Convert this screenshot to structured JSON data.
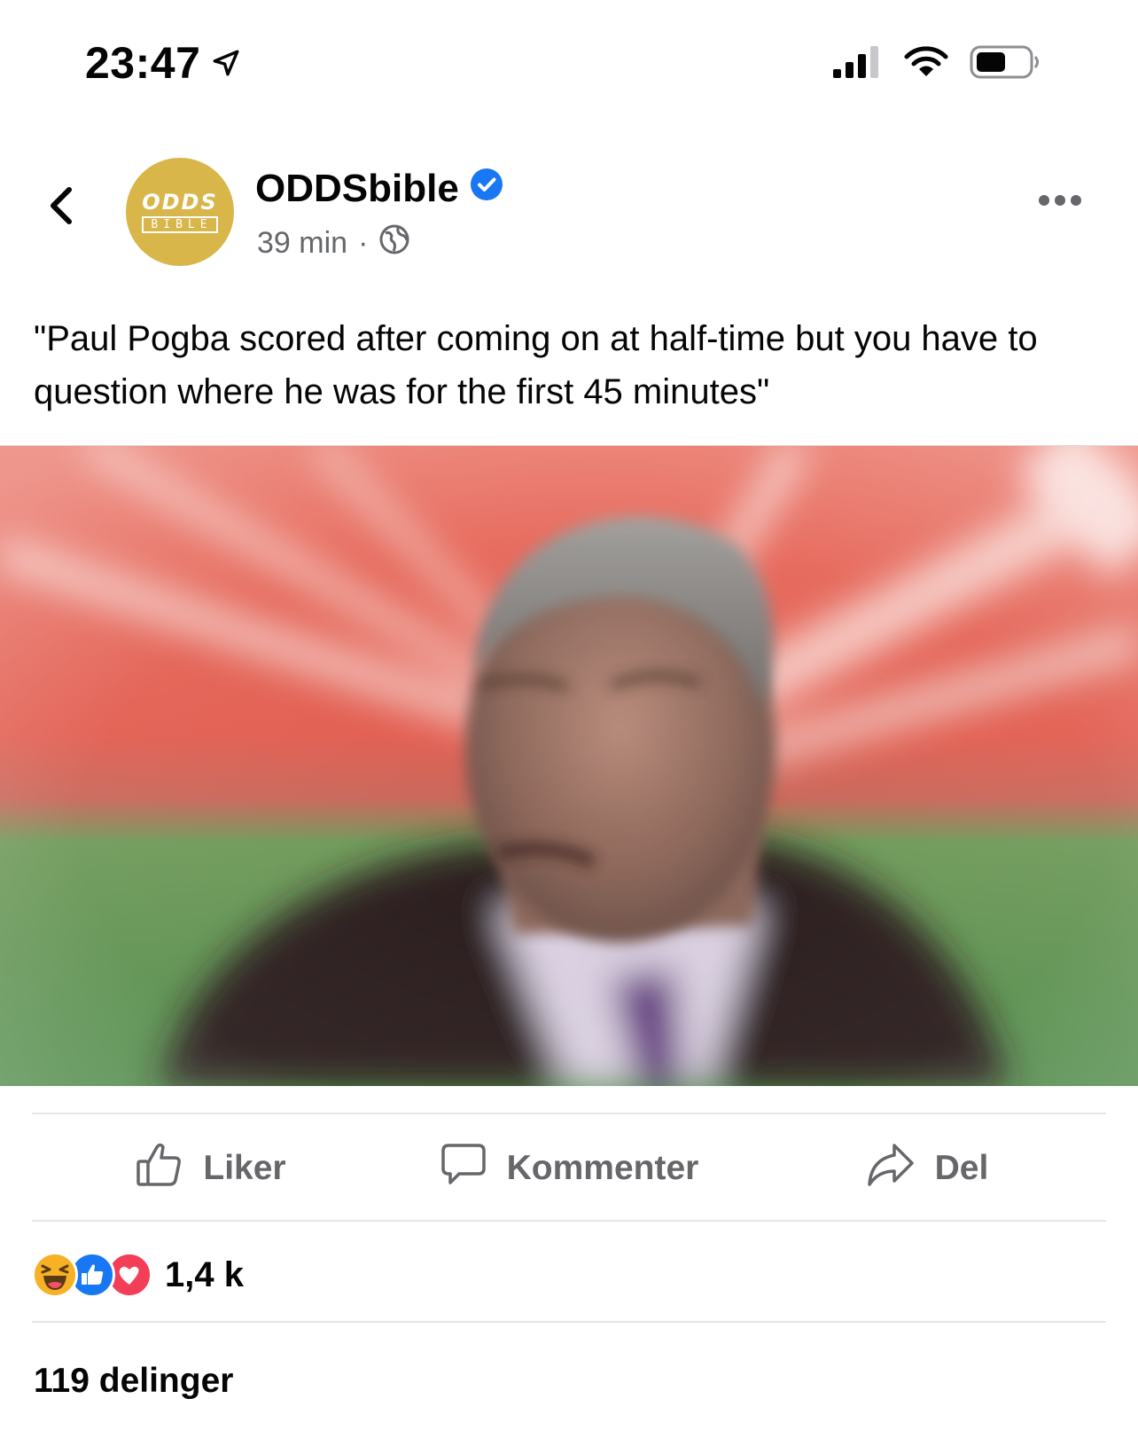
{
  "status_bar": {
    "time": "23:47",
    "icons": [
      "location-arrow-icon",
      "signal-icon",
      "wifi-icon",
      "battery-icon"
    ]
  },
  "post": {
    "page_name": "ODDSbible",
    "verified": true,
    "avatar_text_top": "ODDS",
    "avatar_text_bottom": "BIBLE",
    "time_ago": "39 min",
    "separator": "·",
    "audience_icon": "globe-icon",
    "text": "\"Paul Pogba scored after coming on at half-time but you have to question where he was for the first 45 minutes\"",
    "image_description_icon": "photo"
  },
  "actions": {
    "like_label": "Liker",
    "comment_label": "Kommenter",
    "share_label": "Del"
  },
  "reactions": {
    "types": [
      "haha",
      "like",
      "love"
    ],
    "count": "1,4 k"
  },
  "shares": {
    "label": "119 delinger"
  },
  "colors": {
    "facebook_blue": "#1877f2",
    "verified_blue": "#1877f2",
    "love_red": "#f33e58",
    "haha_yellow": "#f7b125",
    "avatar_gold": "#d8b64a",
    "muted_gray": "#65676b"
  }
}
